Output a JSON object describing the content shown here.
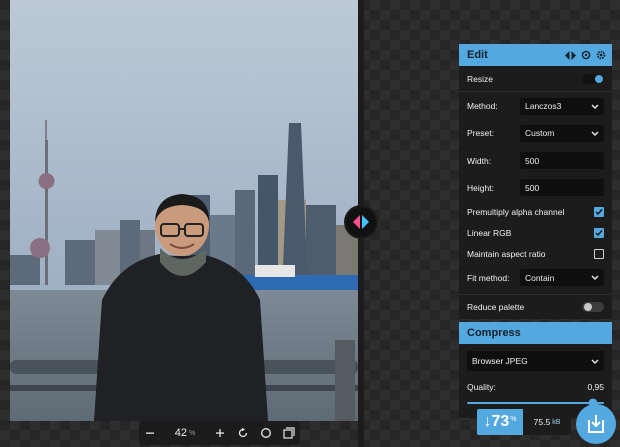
{
  "zoom": {
    "value": "42",
    "unit": "%"
  },
  "edit_panel": {
    "title": "Edit",
    "resize": {
      "label": "Resize",
      "enabled": true
    },
    "method": {
      "label": "Method:",
      "value": "Lanczos3"
    },
    "preset": {
      "label": "Preset:",
      "value": "Custom"
    },
    "width": {
      "label": "Width:",
      "value": "500"
    },
    "height": {
      "label": "Height:",
      "value": "500"
    },
    "premultiply": {
      "label": "Premultiply alpha channel",
      "checked": true
    },
    "linear_rgb": {
      "label": "Linear RGB",
      "checked": true
    },
    "maintain_aspect": {
      "label": "Maintain aspect ratio",
      "checked": false
    },
    "fit_method": {
      "label": "Fit method:",
      "value": "Contain"
    },
    "reduce_palette": {
      "label": "Reduce palette",
      "enabled": false
    }
  },
  "compress_panel": {
    "title": "Compress",
    "encoder": {
      "value": "Browser JPEG"
    },
    "quality": {
      "label": "Quality:",
      "value": "0.95",
      "display": "0,95"
    }
  },
  "result": {
    "arrow": "↓",
    "percent": "73",
    "percent_unit": "%",
    "size": "75.5",
    "size_unit": "kB"
  },
  "colors": {
    "accent": "#54a8e0",
    "panel": "#1c1c1c",
    "divider_handle_left": "#ff4d8d",
    "divider_handle_right": "#40c4ff"
  }
}
